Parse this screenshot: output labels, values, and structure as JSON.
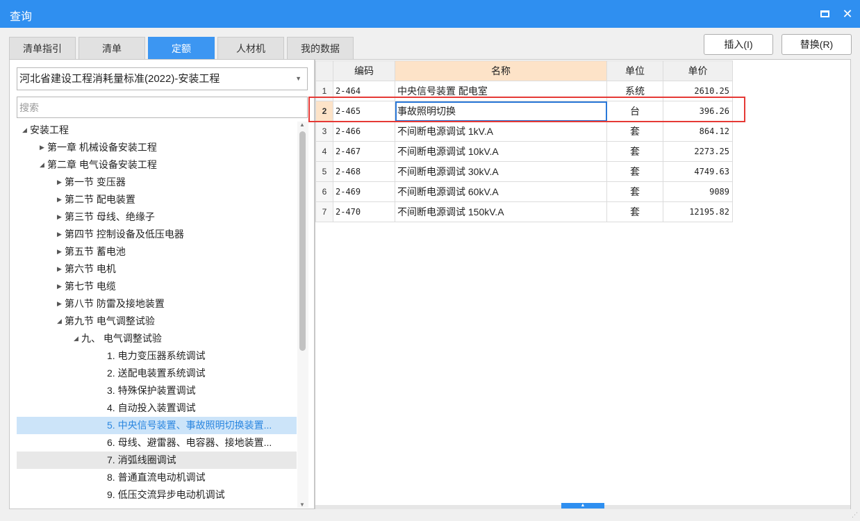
{
  "window": {
    "title": "查询"
  },
  "tabs": [
    {
      "label": "清单指引",
      "active": false
    },
    {
      "label": "清单",
      "active": false
    },
    {
      "label": "定额",
      "active": true
    },
    {
      "label": "人材机",
      "active": false
    },
    {
      "label": "我的数据",
      "active": false
    }
  ],
  "toolbar": {
    "insert_label": "插入(I)",
    "replace_label": "替换(R)"
  },
  "library_select": {
    "value": "河北省建设工程消耗量标准(2022)-安装工程"
  },
  "search": {
    "placeholder": "搜索",
    "value": ""
  },
  "tree": [
    {
      "label": "安装工程",
      "level": 0,
      "state": "expanded"
    },
    {
      "label": "第一章 机械设备安装工程",
      "level": 1,
      "state": "collapsed"
    },
    {
      "label": "第二章 电气设备安装工程",
      "level": 1,
      "state": "expanded"
    },
    {
      "label": "第一节 变压器",
      "level": 2,
      "state": "collapsed"
    },
    {
      "label": "第二节 配电装置",
      "level": 2,
      "state": "collapsed"
    },
    {
      "label": "第三节 母线、绝缘子",
      "level": 2,
      "state": "collapsed"
    },
    {
      "label": "第四节 控制设备及低压电器",
      "level": 2,
      "state": "collapsed"
    },
    {
      "label": "第五节 蓄电池",
      "level": 2,
      "state": "collapsed"
    },
    {
      "label": "第六节 电机",
      "level": 2,
      "state": "collapsed"
    },
    {
      "label": "第七节 电缆",
      "level": 2,
      "state": "collapsed"
    },
    {
      "label": "第八节 防雷及接地装置",
      "level": 2,
      "state": "collapsed"
    },
    {
      "label": "第九节 电气调整试验",
      "level": 2,
      "state": "expanded"
    },
    {
      "label": "九、 电气调整试验",
      "level": 3,
      "state": "expanded"
    },
    {
      "label": "1. 电力变压器系统调试",
      "level": 4,
      "state": "leaf"
    },
    {
      "label": "2. 送配电装置系统调试",
      "level": 4,
      "state": "leaf"
    },
    {
      "label": "3. 特殊保护装置调试",
      "level": 4,
      "state": "leaf"
    },
    {
      "label": "4. 自动投入装置调试",
      "level": 4,
      "state": "leaf"
    },
    {
      "label": "5. 中央信号装置、事故照明切换装置...",
      "level": 4,
      "state": "leaf",
      "selected": true
    },
    {
      "label": "6. 母线、避雷器、电容器、接地装置...",
      "level": 4,
      "state": "leaf"
    },
    {
      "label": "7. 消弧线圈调试",
      "level": 4,
      "state": "leaf",
      "hover": true
    },
    {
      "label": "8. 普通直流电动机调试",
      "level": 4,
      "state": "leaf"
    },
    {
      "label": "9. 低压交流异步电动机调试",
      "level": 4,
      "state": "leaf"
    }
  ],
  "table": {
    "headers": {
      "code": "编码",
      "name": "名称",
      "unit": "单位",
      "price": "单价"
    },
    "rows": [
      {
        "no": "1",
        "code": "2-464",
        "name": "中央信号装置 配电室",
        "unit": "系统",
        "price": "2610.25"
      },
      {
        "no": "2",
        "code": "2-465",
        "name": "事故照明切换",
        "unit": "台",
        "price": "396.26",
        "active": true
      },
      {
        "no": "3",
        "code": "2-466",
        "name": "不间断电源调试 1kV.A",
        "unit": "套",
        "price": "864.12"
      },
      {
        "no": "4",
        "code": "2-467",
        "name": "不间断电源调试 10kV.A",
        "unit": "套",
        "price": "2273.25"
      },
      {
        "no": "5",
        "code": "2-468",
        "name": "不间断电源调试 30kV.A",
        "unit": "套",
        "price": "4749.63"
      },
      {
        "no": "6",
        "code": "2-469",
        "name": "不间断电源调试 60kV.A",
        "unit": "套",
        "price": "9089"
      },
      {
        "no": "7",
        "code": "2-470",
        "name": "不间断电源调试 150kV.A",
        "unit": "套",
        "price": "12195.82"
      }
    ]
  },
  "icons": {
    "maximize": "maximize-icon",
    "close": "close-icon",
    "dropdown": "chevron-down-icon",
    "expanded": "triangle-down-icon",
    "collapsed": "triangle-right-icon"
  },
  "colors": {
    "accent": "#2f8ff0",
    "selected_row": "#cce4f9",
    "highlight_box": "#e53935",
    "sorted_header": "#fde3c8"
  }
}
